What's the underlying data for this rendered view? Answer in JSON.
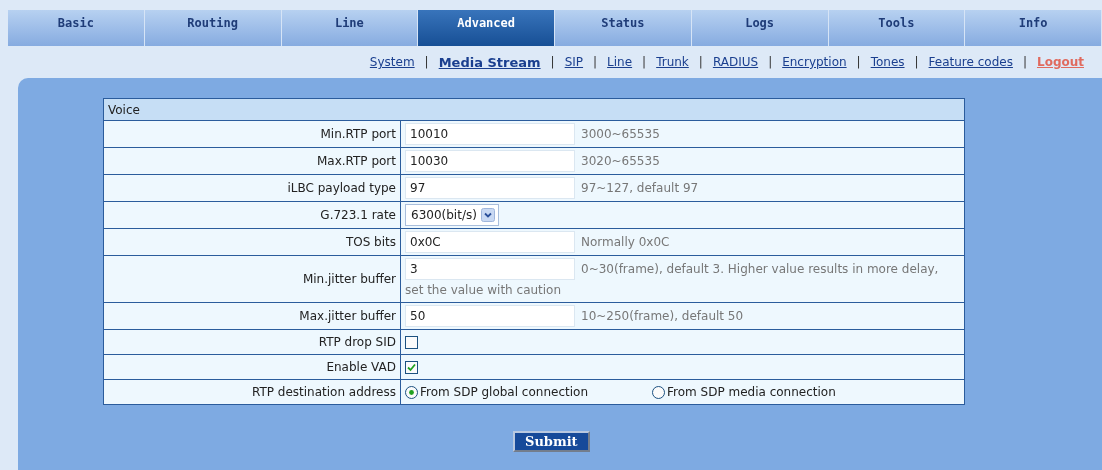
{
  "tabs": [
    {
      "label": "Basic",
      "selected": false
    },
    {
      "label": "Routing",
      "selected": false
    },
    {
      "label": "Line",
      "selected": false
    },
    {
      "label": "Advanced",
      "selected": true
    },
    {
      "label": "Status",
      "selected": false
    },
    {
      "label": "Logs",
      "selected": false
    },
    {
      "label": "Tools",
      "selected": false
    },
    {
      "label": "Info",
      "selected": false
    }
  ],
  "subnav": [
    {
      "kind": "link",
      "label": "System",
      "selected": false
    },
    {
      "kind": "sep",
      "label": "|"
    },
    {
      "kind": "link",
      "label": "Media Stream",
      "selected": true
    },
    {
      "kind": "sep",
      "label": "|"
    },
    {
      "kind": "link",
      "label": "SIP",
      "selected": false
    },
    {
      "kind": "sep",
      "label": "|"
    },
    {
      "kind": "link",
      "label": "Line",
      "selected": false
    },
    {
      "kind": "sep",
      "label": "|"
    },
    {
      "kind": "link",
      "label": "Trunk",
      "selected": false
    },
    {
      "kind": "sep",
      "label": "|"
    },
    {
      "kind": "link",
      "label": "RADIUS",
      "selected": false
    },
    {
      "kind": "sep",
      "label": "|"
    },
    {
      "kind": "link",
      "label": "Encryption",
      "selected": false
    },
    {
      "kind": "sep",
      "label": "|"
    },
    {
      "kind": "link",
      "label": "Tones",
      "selected": false
    },
    {
      "kind": "sep",
      "label": "|"
    },
    {
      "kind": "link",
      "label": "Feature codes",
      "selected": false
    },
    {
      "kind": "sep",
      "label": "|"
    },
    {
      "kind": "logout",
      "label": "Logout",
      "selected": false
    }
  ],
  "section": {
    "title": "Voice"
  },
  "rows": [
    {
      "kind": "text",
      "label": "Min.RTP port",
      "value": "10010",
      "hint": "3000~65535"
    },
    {
      "kind": "text",
      "label": "Max.RTP port",
      "value": "10030",
      "hint": "3020~65535"
    },
    {
      "kind": "text",
      "label": "iLBC payload type",
      "value": "97",
      "hint": "97~127, default 97"
    },
    {
      "kind": "select",
      "label": "G.723.1 rate",
      "value": "6300(bit/s)"
    },
    {
      "kind": "text",
      "label": "TOS bits",
      "value": "0x0C",
      "hint": "Normally 0x0C"
    },
    {
      "kind": "text",
      "label": "Min.jitter buffer",
      "value": "3",
      "hint": "0~30(frame), default 3. Higher value results in more delay,",
      "note": "set the value with caution"
    },
    {
      "kind": "text",
      "label": "Max.jitter buffer",
      "value": "50",
      "hint": "10~250(frame), default 50"
    },
    {
      "kind": "checkbox",
      "label": "RTP drop SID",
      "checked": false
    },
    {
      "kind": "checkbox",
      "label": "Enable VAD",
      "checked": true
    },
    {
      "kind": "radio",
      "label": "RTP destination address",
      "options": [
        {
          "label": "From SDP global connection",
          "selected": true
        },
        {
          "label": "From SDP media connection",
          "selected": false
        }
      ]
    }
  ],
  "submit": "Submit"
}
